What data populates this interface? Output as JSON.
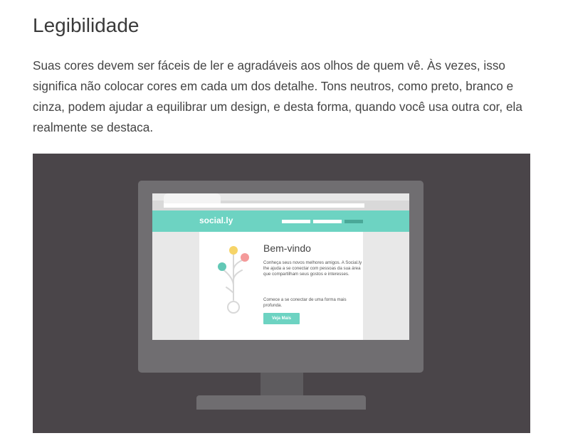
{
  "article": {
    "heading": "Legibilidade",
    "paragraph": "Suas cores devem ser fáceis de ler e agradáveis aos olhos de quem vê. Às vezes, isso significa não colocar cores em cada um dos detalhe. Tons neutros, como preto, branco e cinza, podem ajudar a equilibrar um design, e desta forma, quando você usa outra cor, ela realmente se destaca."
  },
  "illustration": {
    "site_logo": "social.ly",
    "welcome_title": "Bem-vindo",
    "welcome_text": "Conheça seus novos melhores amigos. A Social.ly lhe ajuda a se conectar com pessoas da sua área que compartilham seus gostos e interesses.",
    "welcome_text_2": "Comece a se conectar de uma forma mais profunda.",
    "cta_label": "Veja Mais",
    "colors": {
      "background": "#4a4549",
      "monitor": "#706e71",
      "accent": "#6dd3c2",
      "dot_yellow": "#f6d468",
      "dot_pink": "#f49a9a",
      "dot_teal": "#62c8b6"
    }
  }
}
